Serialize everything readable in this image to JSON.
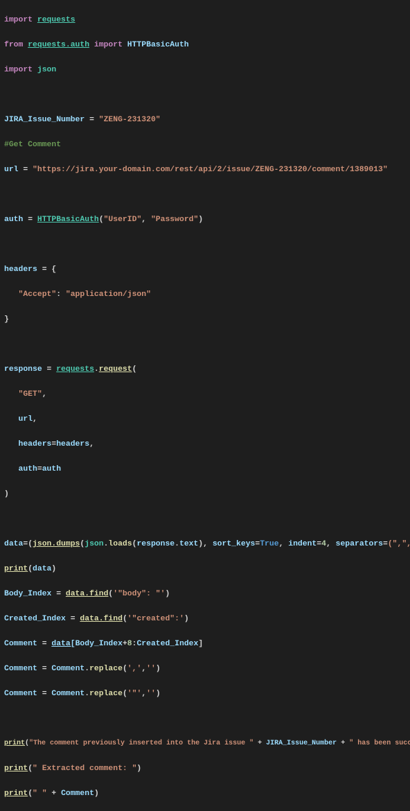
{
  "lines": {
    "l1_import": "import",
    "l1_requests": "requests",
    "l2_from": "from",
    "l2_mod": "requests.auth",
    "l2_import": "import",
    "l2_httpbasic": "HTTPBasicAuth",
    "l3_import": "import",
    "l3_json": "json",
    "l5_var": "JIRA_Issue_Number",
    "l5_val": "\"ZENG-231320\"",
    "l6_cmt": "#Get Comment",
    "l7_var": "url",
    "l7_val": "\"https://jira.your-domain.com/rest/api/2/issue/ZENG-231320/comment/1389013\"",
    "l9_var": "auth",
    "l9_fn": "HTTPBasicAuth",
    "l9_a1": "\"UserID\"",
    "l9_a2": "\"Password\"",
    "l11_var": "headers",
    "l12_key": "\"Accept\"",
    "l12_val": "\"application/json\"",
    "l15_var": "response",
    "l15_mod": "requests",
    "l15_fn": "request",
    "l16_get": "\"GET\"",
    "l17_url": "url",
    "l18_headers_kw": "headers",
    "l18_headers_v": "headers",
    "l19_auth_kw": "auth",
    "l19_auth_v": "auth",
    "l22_var": "data",
    "l22_jsondumps": "json.dumps",
    "l22_json": "json",
    "l22_loads": "loads",
    "l22_resp": "response",
    "l22_text": "text",
    "l22_sort": "sort_keys",
    "l22_true": "True",
    "l22_indent": "indent",
    "l22_indent_v": "4",
    "l22_sep": "separators",
    "l22_sep_v": "(\",\", \": \")",
    "l23_print": "print",
    "l23_arg": "data",
    "l24_var": "Body_Index",
    "l24_fn": "data.find",
    "l24_arg": "'\"body\": \"'",
    "l25_var": "Created_Index",
    "l25_fn": "data.find",
    "l25_arg": "'\"created\":'",
    "l26_var": "Comment",
    "l26_data": "data[",
    "l26_bi": "Body_Index",
    "l26_plus8": "8",
    "l26_ci": "Created_Index",
    "l27_var": "Comment",
    "l27_c": "Comment",
    "l27_rep": "replace",
    "l27_a1": "','",
    "l27_a2": "''",
    "l28_var": "Comment",
    "l28_c": "Comment",
    "l28_rep": "replace",
    "l28_a1": "'\"'",
    "l28_a2": "''",
    "l30_print": "print",
    "l30_s1": "\"The comment previously inserted into the Jira issue \"",
    "l30_jin": "JIRA_Issue_Number",
    "l30_s2": "\" has been successfully retrieved !!!\"",
    "l31_print": "print",
    "l31_arg": "\" Extracted comment: \"",
    "l32_print": "print",
    "l32_s": "\" \"",
    "l32_c": "Comment"
  }
}
